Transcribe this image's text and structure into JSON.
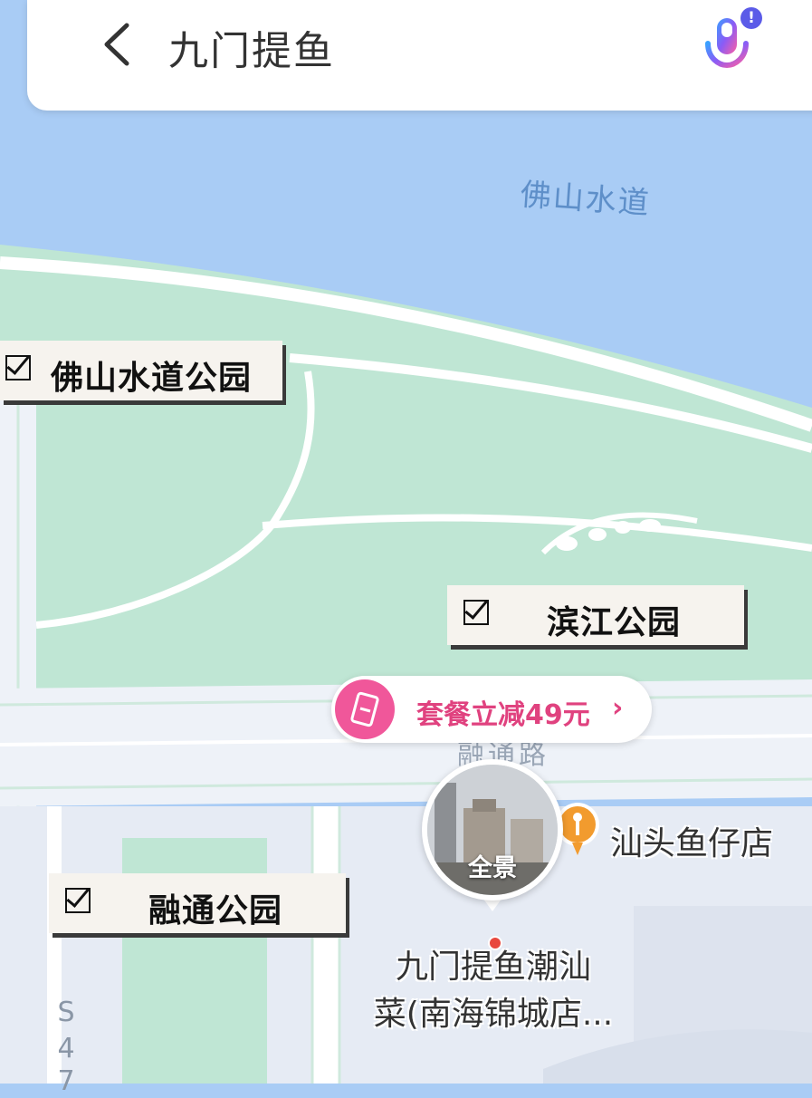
{
  "search": {
    "query": "九门提鱼"
  },
  "map": {
    "water_label": "佛山水道",
    "road_label": "融通路",
    "road_number": [
      "S",
      "4",
      "7"
    ],
    "colors": {
      "water": "#a9ccf5",
      "park": "#bfe6d4",
      "road": "#eef2f8",
      "urban": "#e6ebf4"
    }
  },
  "parks": [
    {
      "label": "佛山水道公园"
    },
    {
      "label": "滨江公园"
    },
    {
      "label": "融通公园"
    }
  ],
  "deal": {
    "text": "套餐立减49元",
    "icon": "ticket-icon",
    "accent": "#e0427f"
  },
  "panorama": {
    "label": "全景"
  },
  "poi": {
    "name_line1": "九门提鱼潮汕",
    "name_line2": "菜(南海锦城店..."
  },
  "shop": {
    "name": "汕头鱼仔店",
    "icon": "food-pin-icon",
    "color": "#f29b2e"
  }
}
